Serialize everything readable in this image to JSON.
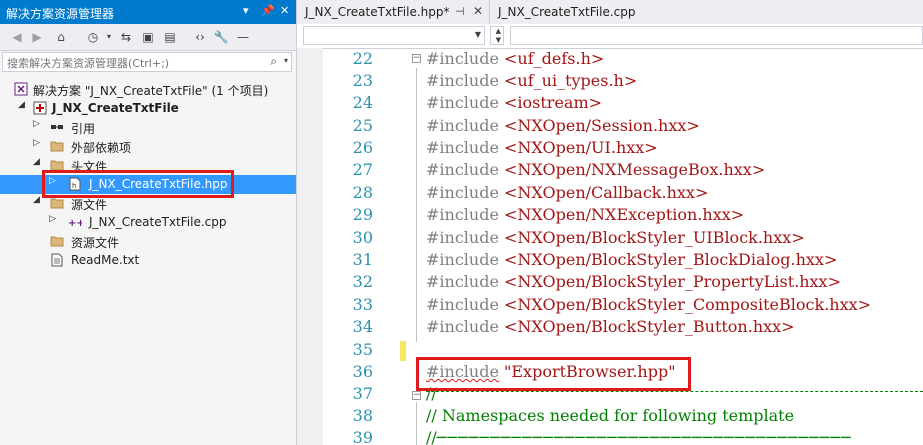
{
  "solution_explorer": {
    "title": "解决方案资源管理器",
    "search_placeholder": "搜索解决方案资源管理器(Ctrl+;)",
    "tree": [
      {
        "label": "解决方案 \"J_NX_CreateTxtFile\" (1 个项目)",
        "icon": "solution-icon"
      },
      {
        "label": "J_NX_CreateTxtFile",
        "icon": "project-icon",
        "bold": true
      },
      {
        "label": "引用",
        "icon": "references-icon"
      },
      {
        "label": "外部依赖项",
        "icon": "folder-icon"
      },
      {
        "label": "头文件",
        "icon": "folder-icon"
      },
      {
        "label": "J_NX_CreateTxtFile.hpp",
        "icon": "header-file-icon",
        "selected": true
      },
      {
        "label": "源文件",
        "icon": "folder-icon"
      },
      {
        "label": "J_NX_CreateTxtFile.cpp",
        "icon": "cpp-file-icon"
      },
      {
        "label": "资源文件",
        "icon": "folder-icon"
      },
      {
        "label": "ReadMe.txt",
        "icon": "text-file-icon"
      }
    ]
  },
  "editor": {
    "tabs": [
      {
        "label": "J_NX_CreateTxtFile.hpp*",
        "active": true
      },
      {
        "label": "J_NX_CreateTxtFile.cpp",
        "active": false
      }
    ],
    "lines": [
      {
        "n": "22",
        "kw": "#include",
        "arg": " <uf_defs.h>"
      },
      {
        "n": "23",
        "kw": "#include",
        "arg": " <uf_ui_types.h>"
      },
      {
        "n": "24",
        "kw": "#include",
        "arg": " <iostream>"
      },
      {
        "n": "25",
        "kw": "#include",
        "arg": " <NXOpen/Session.hxx>"
      },
      {
        "n": "26",
        "kw": "#include",
        "arg": " <NXOpen/UI.hxx>"
      },
      {
        "n": "27",
        "kw": "#include",
        "arg": " <NXOpen/NXMessageBox.hxx>"
      },
      {
        "n": "28",
        "kw": "#include",
        "arg": " <NXOpen/Callback.hxx>"
      },
      {
        "n": "29",
        "kw": "#include",
        "arg": " <NXOpen/NXException.hxx>"
      },
      {
        "n": "30",
        "kw": "#include",
        "arg": " <NXOpen/BlockStyler_UIBlock.hxx>"
      },
      {
        "n": "31",
        "kw": "#include",
        "arg": " <NXOpen/BlockStyler_BlockDialog.hxx>"
      },
      {
        "n": "32",
        "kw": "#include",
        "arg": " <NXOpen/BlockStyler_PropertyList.hxx>"
      },
      {
        "n": "33",
        "kw": "#include",
        "arg": " <NXOpen/BlockStyler_CompositeBlock.hxx>"
      },
      {
        "n": "34",
        "kw": "#include",
        "arg": " <NXOpen/BlockStyler_Button.hxx>"
      },
      {
        "n": "35",
        "kw": "",
        "arg": ""
      },
      {
        "n": "36",
        "kw": "#include",
        "arg": " \"ExportBrowser.hpp\""
      },
      {
        "n": "37",
        "kw": "//",
        "arg": ""
      },
      {
        "n": "38",
        "kw": "",
        "arg": "// Namespaces needed for following template"
      },
      {
        "n": "39",
        "kw": "//",
        "arg": ""
      }
    ]
  },
  "colors": {
    "accent": "#007acc",
    "selection": "#3399ff",
    "highlight_box": "#e01b1b",
    "line_number": "#2b91af",
    "string": "#a31515",
    "comment": "#008000"
  }
}
